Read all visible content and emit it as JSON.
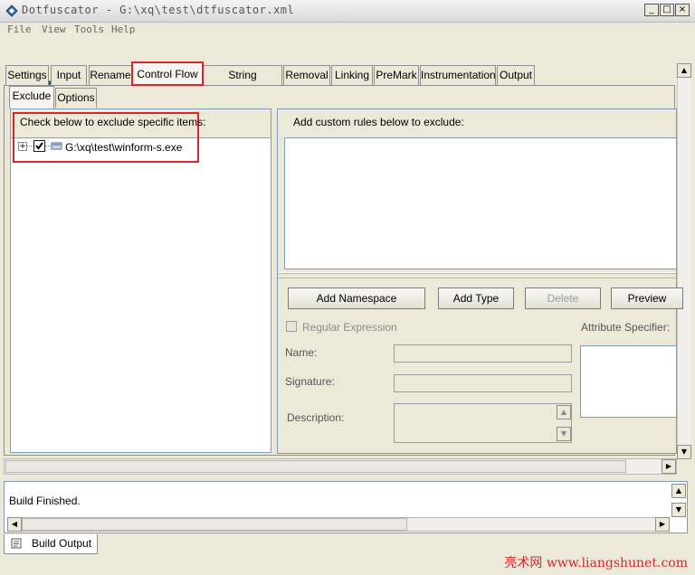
{
  "window": {
    "title": "Dotfuscator - G:\\xq\\test\\dtfuscator.xml",
    "controls": {
      "minimize": "_",
      "maximize": "□",
      "close": "×"
    }
  },
  "menu": [
    "File",
    "View",
    "Tools",
    "Help"
  ],
  "toolbar": {
    "icons": [
      "new-file-icon",
      "open-folder-icon",
      "save-icon",
      "run-icon",
      "help-icon"
    ]
  },
  "tabs": [
    "Settings",
    "Input",
    "Rename",
    "Control Flow",
    "String Encryption",
    "Removal",
    "Linking",
    "PreMark",
    "Instrumentation",
    "Output"
  ],
  "active_tab": "Control Flow",
  "subtabs": [
    "Exclude",
    "Options"
  ],
  "active_subtab": "Exclude",
  "left_pane": {
    "header": "Check below to exclude specific items:",
    "tree_items": [
      {
        "expander": "+",
        "checked": true,
        "label": "G:\\xq\\test\\winform-s.exe"
      }
    ]
  },
  "right_pane": {
    "header": "Add custom rules below to exclude:",
    "buttons": {
      "add_namespace": "Add Namespace",
      "add_type": "Add Type",
      "delete": "Delete",
      "preview": "Preview"
    },
    "regular_expression_label": "Regular Expression",
    "attribute_specifier_label": "Attribute Specifier:",
    "fields": {
      "name_label": "Name:",
      "signature_label": "Signature:",
      "description_label": "Description:"
    }
  },
  "output": {
    "text": "Build Finished.",
    "tab_label": "Build Output"
  },
  "watermark": "亮术网 www.liangshunet.com"
}
